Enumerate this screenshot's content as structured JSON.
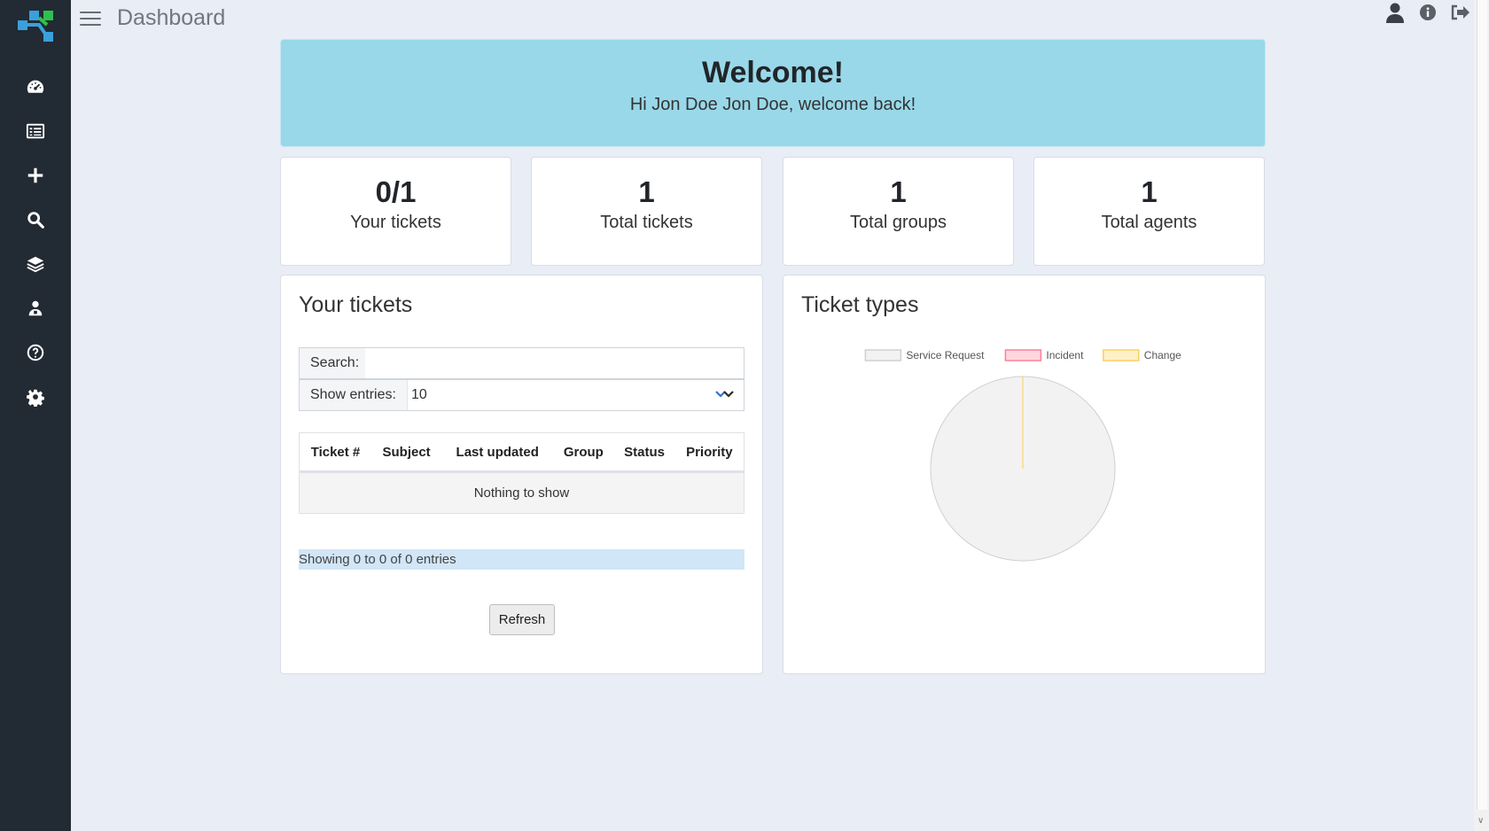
{
  "header": {
    "title": "Dashboard"
  },
  "sidebar": {
    "items": [
      {
        "icon": "dashboard-gauge-icon"
      },
      {
        "icon": "tickets-list-icon"
      },
      {
        "icon": "plus-icon"
      },
      {
        "icon": "search-icon"
      },
      {
        "icon": "layers-icon"
      },
      {
        "icon": "users-icon"
      },
      {
        "icon": "help-circle-icon"
      },
      {
        "icon": "gear-icon"
      }
    ]
  },
  "top_right": {
    "icons": [
      "user-icon",
      "info-icon",
      "logout-icon"
    ]
  },
  "welcome": {
    "title": "Welcome!",
    "message": "Hi Jon Doe Jon Doe, welcome back!"
  },
  "stats": [
    {
      "value": "0/1",
      "label": "Your tickets"
    },
    {
      "value": "1",
      "label": "Total tickets"
    },
    {
      "value": "1",
      "label": "Total groups"
    },
    {
      "value": "1",
      "label": "Total agents"
    }
  ],
  "your_tickets": {
    "title": "Your tickets",
    "search_label": "Search:",
    "search_value": "",
    "show_entries_label": "Show entries:",
    "show_entries_value": "10",
    "columns": [
      "Ticket #",
      "Subject",
      "Last updated",
      "Group",
      "Status",
      "Priority"
    ],
    "empty_text": "Nothing to show",
    "info": "Showing 0 to 0 of 0 entries",
    "refresh_label": "Refresh"
  },
  "ticket_types": {
    "title": "Ticket types",
    "colors": {
      "Service Request": "#f2f2f2",
      "Incident": "#ffd6de",
      "Change": "#fff0c8"
    }
  },
  "chart_data": {
    "type": "pie",
    "title": "Ticket types",
    "categories": [
      "Service Request",
      "Incident",
      "Change"
    ],
    "values": [
      1,
      0,
      0
    ],
    "legend_position": "top"
  }
}
